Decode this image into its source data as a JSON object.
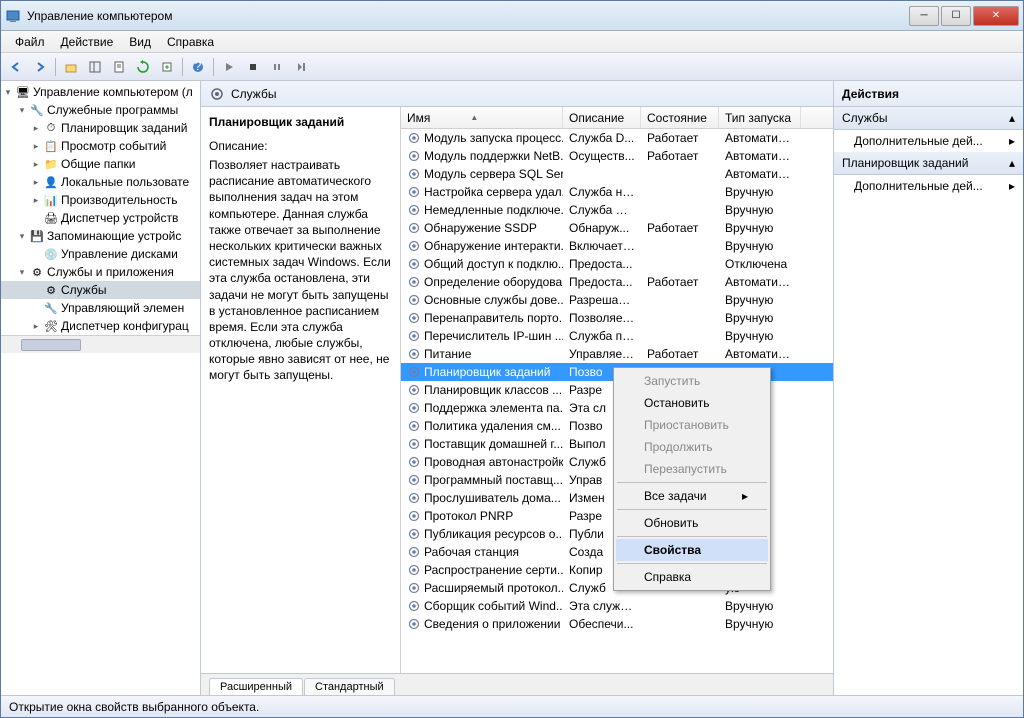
{
  "window": {
    "title": "Управление компьютером"
  },
  "menubar": [
    "Файл",
    "Действие",
    "Вид",
    "Справка"
  ],
  "tree": [
    {
      "level": 0,
      "expand": "▾",
      "icon": "🖥",
      "label": "Управление компьютером (л"
    },
    {
      "level": 1,
      "expand": "▾",
      "icon": "🔧",
      "label": "Служебные программы"
    },
    {
      "level": 2,
      "expand": "▸",
      "icon": "⏱",
      "label": "Планировщик заданий"
    },
    {
      "level": 2,
      "expand": "▸",
      "icon": "📋",
      "label": "Просмотр событий"
    },
    {
      "level": 2,
      "expand": "▸",
      "icon": "📁",
      "label": "Общие папки"
    },
    {
      "level": 2,
      "expand": "▸",
      "icon": "👤",
      "label": "Локальные пользовате"
    },
    {
      "level": 2,
      "expand": "▸",
      "icon": "📊",
      "label": "Производительность"
    },
    {
      "level": 2,
      "expand": "",
      "icon": "🖨",
      "label": "Диспетчер устройств"
    },
    {
      "level": 1,
      "expand": "▾",
      "icon": "💾",
      "label": "Запоминающие устройс"
    },
    {
      "level": 2,
      "expand": "",
      "icon": "💿",
      "label": "Управление дисками"
    },
    {
      "level": 1,
      "expand": "▾",
      "icon": "⚙",
      "label": "Службы и приложения"
    },
    {
      "level": 2,
      "expand": "",
      "icon": "⚙",
      "label": "Службы",
      "selected": true
    },
    {
      "level": 2,
      "expand": "",
      "icon": "🔧",
      "label": "Управляющий элемен"
    },
    {
      "level": 2,
      "expand": "▸",
      "icon": "🛠",
      "label": "Диспетчер конфигурац"
    }
  ],
  "services_header": "Службы",
  "desc": {
    "title": "Планировщик заданий",
    "label": "Описание:",
    "text": "Позволяет настраивать расписание автоматического выполнения задач на этом компьютере. Данная служба также отвечает за выполнение нескольких критически важных системных задач Windows. Если эта служба остановлена, эти задачи не могут быть запущены в установленное расписанием время. Если эта служба отключена, любые службы, которые явно зависят от нее, не могут быть запущены."
  },
  "columns": {
    "name": "Имя",
    "desc": "Описание",
    "state": "Состояние",
    "start": "Тип запуска"
  },
  "rows": [
    {
      "name": "Модуль запуска процесс...",
      "desc": "Служба D...",
      "state": "Работает",
      "start": "Автоматиче..."
    },
    {
      "name": "Модуль поддержки NetB...",
      "desc": "Осуществ...",
      "state": "Работает",
      "start": "Автоматиче..."
    },
    {
      "name": "Модуль сервера SQL Ser...",
      "desc": "",
      "state": "",
      "start": "Автоматиче..."
    },
    {
      "name": "Настройка сервера удал...",
      "desc": "Служба на...",
      "state": "",
      "start": "Вручную"
    },
    {
      "name": "Немедленные подключе...",
      "desc": "Служба W...",
      "state": "",
      "start": "Вручную"
    },
    {
      "name": "Обнаружение SSDP",
      "desc": "Обнаруж...",
      "state": "Работает",
      "start": "Вручную"
    },
    {
      "name": "Обнаружение интеракти...",
      "desc": "Включает ...",
      "state": "",
      "start": "Вручную"
    },
    {
      "name": "Общий доступ к подклю...",
      "desc": "Предоста...",
      "state": "",
      "start": "Отключена"
    },
    {
      "name": "Определение оборудова...",
      "desc": "Предоста...",
      "state": "Работает",
      "start": "Автоматиче..."
    },
    {
      "name": "Основные службы дове...",
      "desc": "Разрешает ...",
      "state": "",
      "start": "Вручную"
    },
    {
      "name": "Перенаправитель порто...",
      "desc": "Позволяет...",
      "state": "",
      "start": "Вручную"
    },
    {
      "name": "Перечислитель IP-шин ...",
      "desc": "Служба пе...",
      "state": "",
      "start": "Вручную"
    },
    {
      "name": "Питание",
      "desc": "Управляет ...",
      "state": "Работает",
      "start": "Автоматиче..."
    },
    {
      "name": "Планировщик заданий",
      "desc": "Позво",
      "state": "",
      "start": "атиче...",
      "selected": true
    },
    {
      "name": "Планировщик классов ...",
      "desc": "Разре",
      "state": "",
      "start": "атиче..."
    },
    {
      "name": "Поддержка элемента па...",
      "desc": "Эта сл",
      "state": "",
      "start": "ую"
    },
    {
      "name": "Политика удаления см...",
      "desc": "Позво",
      "state": "",
      "start": "ую"
    },
    {
      "name": "Поставщик домашней г...",
      "desc": "Выпол",
      "state": "",
      "start": "ую"
    },
    {
      "name": "Проводная автонастройка",
      "desc": "Служб",
      "state": "",
      "start": "ую"
    },
    {
      "name": "Программный поставщ...",
      "desc": "Управ",
      "state": "",
      "start": "ую"
    },
    {
      "name": "Прослушиватель дома...",
      "desc": "Измен",
      "state": "",
      "start": "ую"
    },
    {
      "name": "Протокол PNRP",
      "desc": "Разре",
      "state": "",
      "start": "ую"
    },
    {
      "name": "Публикация ресурсов о...",
      "desc": "Публи",
      "state": "",
      "start": "ую"
    },
    {
      "name": "Рабочая станция",
      "desc": "Созда",
      "state": "",
      "start": "атиче..."
    },
    {
      "name": "Распространение серти...",
      "desc": "Копир",
      "state": "",
      "start": "ую"
    },
    {
      "name": "Расширяемый протокол...",
      "desc": "Служб",
      "state": "",
      "start": "ую"
    },
    {
      "name": "Сборщик событий Wind...",
      "desc": "Эта служб...",
      "state": "",
      "start": "Вручную"
    },
    {
      "name": "Сведения о приложении",
      "desc": "Обеспечи...",
      "state": "",
      "start": "Вручную"
    }
  ],
  "tabs": {
    "extended": "Расширенный",
    "standard": "Стандартный"
  },
  "actions": {
    "header": "Действия",
    "section1": "Службы",
    "link1": "Дополнительные дей...",
    "section2": "Планировщик заданий",
    "link2": "Дополнительные дей..."
  },
  "context": {
    "start": "Запустить",
    "stop": "Остановить",
    "pause": "Приостановить",
    "resume": "Продолжить",
    "restart": "Перезапустить",
    "alltasks": "Все задачи",
    "refresh": "Обновить",
    "properties": "Свойства",
    "help": "Справка"
  },
  "statusbar": "Открытие окна свойств выбранного объекта."
}
